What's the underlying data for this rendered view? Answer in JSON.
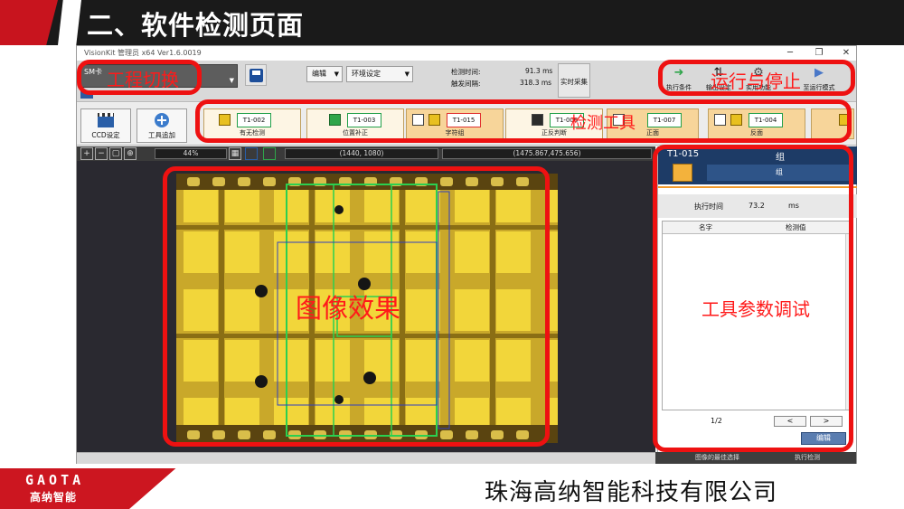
{
  "slide": {
    "title": "二、软件检测页面",
    "company": "珠海高纳智能科技有限公司",
    "logo_en": "GAOTA",
    "logo_cn": "高纳智能"
  },
  "window": {
    "title": "VisionKit  管理员  x64  Ver1.6.0019",
    "min": "─",
    "restore": "❐",
    "close": "✕"
  },
  "toolbar1": {
    "project_combo_label": "SM卡",
    "edit_menu": "编辑",
    "env_menu": "环境设定",
    "detect_time_label": "检测时间:",
    "detect_time_value": "91.3 ms",
    "trigger_interval_label": "触发间隔:",
    "trigger_interval_value": "318.3 ms",
    "realtime_button": "实时采集",
    "exec_condition": "执行条件",
    "output_settings": "输出设定",
    "practical_function": "实用功能",
    "to_run_mode": "至运行模式"
  },
  "toolbar2": {
    "ccd_button": "CCD设定",
    "add_tool_button": "工具追加",
    "tools": [
      {
        "id": "T1-002",
        "sub": "有无检测"
      },
      {
        "id": "T1-003",
        "sub": "位置补正"
      },
      {
        "id": "T1-015",
        "sub": "字符组"
      },
      {
        "id": "T1-006",
        "sub": "正反判断"
      },
      {
        "id": "T1-007",
        "sub": "正面"
      },
      {
        "id": "T1-004",
        "sub": "反面"
      }
    ]
  },
  "statusbar": {
    "zoom": "44%",
    "resolution": "(1440, 1080)",
    "cursor": "(1475.867,475.656)"
  },
  "panel": {
    "tool_id": "T1-015",
    "group_label": "组",
    "tab_label": "组",
    "exec_time_label": "执行时间",
    "exec_time_value": "73.2",
    "exec_time_unit": "ms",
    "col_name": "名字",
    "col_value": "检测值",
    "page": "1/2",
    "prev": "<",
    "next": ">",
    "edit": "编辑"
  },
  "bottom": {
    "left_button": "图像的最佳选择",
    "right_button": "执行检测"
  },
  "annotations": {
    "project_switch": "工程切换",
    "run_stop": "运行与停止",
    "detection_tools": "检测工具",
    "image_effect": "图像效果",
    "tool_param_debug": "工具参数调试"
  },
  "colors": {
    "annotation_red": "#ee1111",
    "header_dark": "#1a1a1a",
    "brand_red": "#cc1620",
    "panel_navy": "#1d3b66"
  }
}
